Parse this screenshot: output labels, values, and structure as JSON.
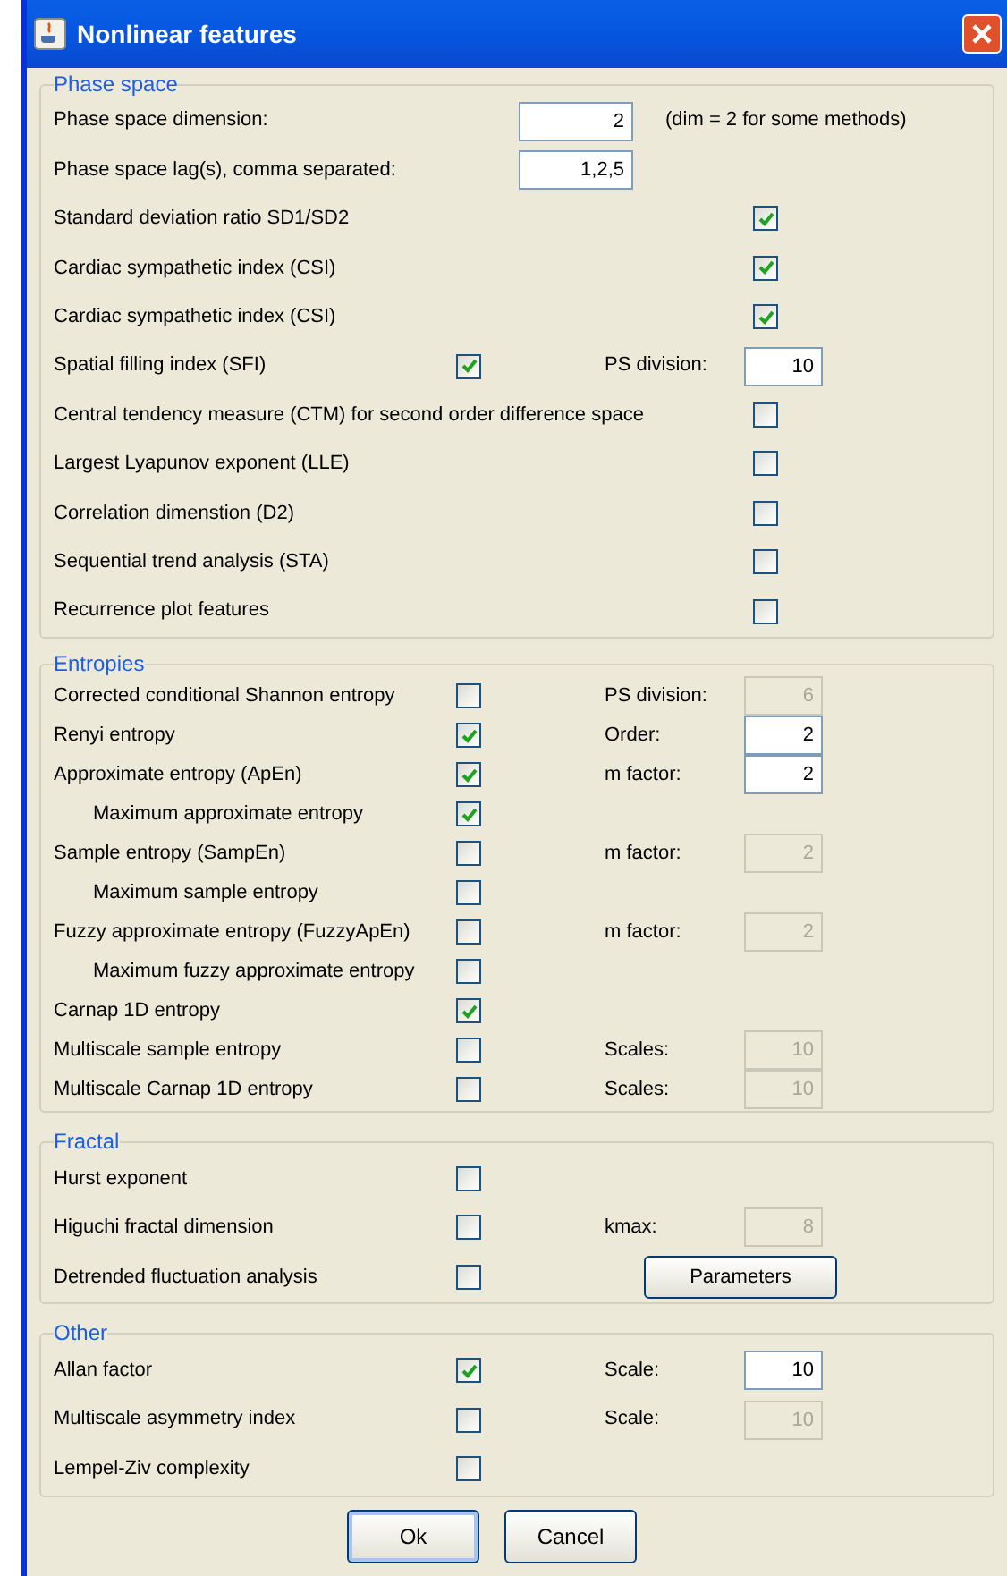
{
  "window": {
    "title": "Nonlinear features"
  },
  "sections": [
    {
      "title": "Phase space",
      "rows": [
        {
          "kind": "input",
          "label": "Phase space dimension:",
          "value": "2",
          "note": "(dim = 2 for some methods)"
        },
        {
          "kind": "input",
          "label": "Phase space lag(s), comma separated:",
          "value": "1,2,5"
        },
        {
          "kind": "wide",
          "label": "Standard deviation ratio SD1/SD2",
          "checked": true
        },
        {
          "kind": "wide",
          "label": "Cardiac sympathetic index (CSI)",
          "checked": true
        },
        {
          "kind": "wide",
          "label": "Cardiac sympathetic index (CSI)",
          "checked": true
        },
        {
          "kind": "check",
          "label": "Spatial filling index (SFI)",
          "checked": true,
          "param": {
            "label": "PS division:",
            "value": "10",
            "disabled": false
          }
        },
        {
          "kind": "wide",
          "label": "Central tendency measure (CTM) for second order difference space",
          "checked": false
        },
        {
          "kind": "wide",
          "label": "Largest Lyapunov exponent (LLE)",
          "checked": false
        },
        {
          "kind": "wide",
          "label": "Correlation dimenstion (D2)",
          "checked": false
        },
        {
          "kind": "wide",
          "label": "Sequential trend analysis (STA)",
          "checked": false
        },
        {
          "kind": "wide",
          "label": "Recurrence plot features",
          "checked": false
        }
      ]
    },
    {
      "title": "Entropies",
      "rows": [
        {
          "kind": "check",
          "label": "Corrected conditional Shannon entropy",
          "checked": false,
          "param": {
            "label": "PS division:",
            "value": "6",
            "disabled": true
          }
        },
        {
          "kind": "check",
          "label": "Renyi entropy",
          "checked": true,
          "param": {
            "label": "Order:",
            "value": "2",
            "disabled": false
          }
        },
        {
          "kind": "check",
          "label": "Approximate entropy (ApEn)",
          "checked": true,
          "param": {
            "label": "m factor:",
            "value": "2",
            "disabled": false
          }
        },
        {
          "kind": "sub",
          "label": "Maximum approximate entropy",
          "checked": true
        },
        {
          "kind": "check",
          "label": "Sample entropy (SampEn)",
          "checked": false,
          "param": {
            "label": "m factor:",
            "value": "2",
            "disabled": true
          }
        },
        {
          "kind": "sub",
          "label": "Maximum sample entropy",
          "checked": false
        },
        {
          "kind": "check",
          "label": "Fuzzy approximate entropy (FuzzyApEn)",
          "checked": false,
          "param": {
            "label": "m factor:",
            "value": "2",
            "disabled": true
          }
        },
        {
          "kind": "sub",
          "label": "Maximum fuzzy approximate entropy",
          "checked": false
        },
        {
          "kind": "check",
          "label": "Carnap 1D entropy",
          "checked": true
        },
        {
          "kind": "check",
          "label": "Multiscale sample entropy",
          "checked": false,
          "param": {
            "label": "Scales:",
            "value": "10",
            "disabled": true
          }
        },
        {
          "kind": "check",
          "label": "Multiscale Carnap 1D entropy",
          "checked": false,
          "param": {
            "label": "Scales:",
            "value": "10",
            "disabled": true
          }
        }
      ]
    },
    {
      "title": "Fractal",
      "rows": [
        {
          "kind": "check",
          "label": "Hurst exponent",
          "checked": false
        },
        {
          "kind": "check",
          "label": "Higuchi fractal dimension",
          "checked": false,
          "param": {
            "label": "kmax:",
            "value": "8",
            "disabled": true
          }
        },
        {
          "kind": "check",
          "label": "Detrended fluctuation analysis",
          "checked": false,
          "button": "Parameters"
        }
      ]
    },
    {
      "title": "Other",
      "rows": [
        {
          "kind": "check",
          "label": "Allan factor",
          "checked": true,
          "param": {
            "label": "Scale:",
            "value": "10",
            "disabled": false
          }
        },
        {
          "kind": "check",
          "label": "Multiscale asymmetry index",
          "checked": false,
          "param": {
            "label": "Scale:",
            "value": "10",
            "disabled": true
          }
        },
        {
          "kind": "check",
          "label": "Lempel-Ziv complexity",
          "checked": false
        }
      ]
    }
  ],
  "buttons": [
    "Ok",
    "Cancel"
  ]
}
